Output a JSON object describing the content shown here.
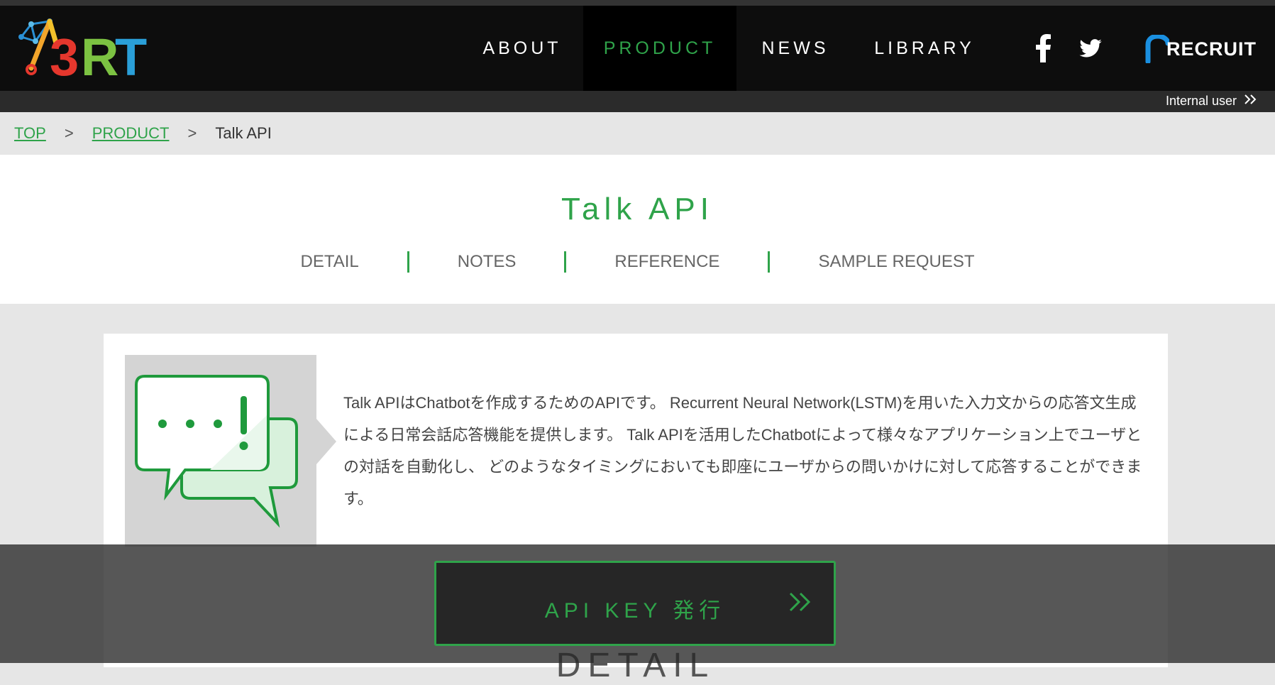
{
  "brand": {
    "logo_text": "A3RT",
    "partner": "RECRUIT"
  },
  "nav": {
    "items": [
      {
        "label": "ABOUT"
      },
      {
        "label": "PRODUCT",
        "active": true
      },
      {
        "label": "NEWS"
      },
      {
        "label": "LIBRARY"
      }
    ],
    "social": [
      "facebook-icon",
      "twitter-icon"
    ]
  },
  "subbar": {
    "internal_user": "Internal user"
  },
  "breadcrumb": {
    "top": "TOP",
    "product": "PRODUCT",
    "current": "Talk API",
    "separator": ">"
  },
  "page": {
    "title": "Talk API",
    "tabs": [
      {
        "label": "DETAIL"
      },
      {
        "label": "NOTES"
      },
      {
        "label": "REFERENCE"
      },
      {
        "label": "SAMPLE REQUEST"
      }
    ]
  },
  "main": {
    "description": "Talk APIはChatbotを作成するためのAPIです。 Recurrent Neural Network(LSTM)を用いた入力文からの応答文生成による日常会話応答機能を提供します。 Talk APIを活用したChatbotによって様々なアプリケーション上でユーザとの対話を自動化し、 どのようなタイミングにおいても即座にユーザからの問いかけに対して応答することができます。",
    "section_heading": "DETAIL"
  },
  "cta": {
    "api_key_label": "API KEY 発行"
  },
  "colors": {
    "accent": "#2fa34a",
    "header_bg": "#0d0d0d",
    "page_bg": "#e6e6e6"
  }
}
